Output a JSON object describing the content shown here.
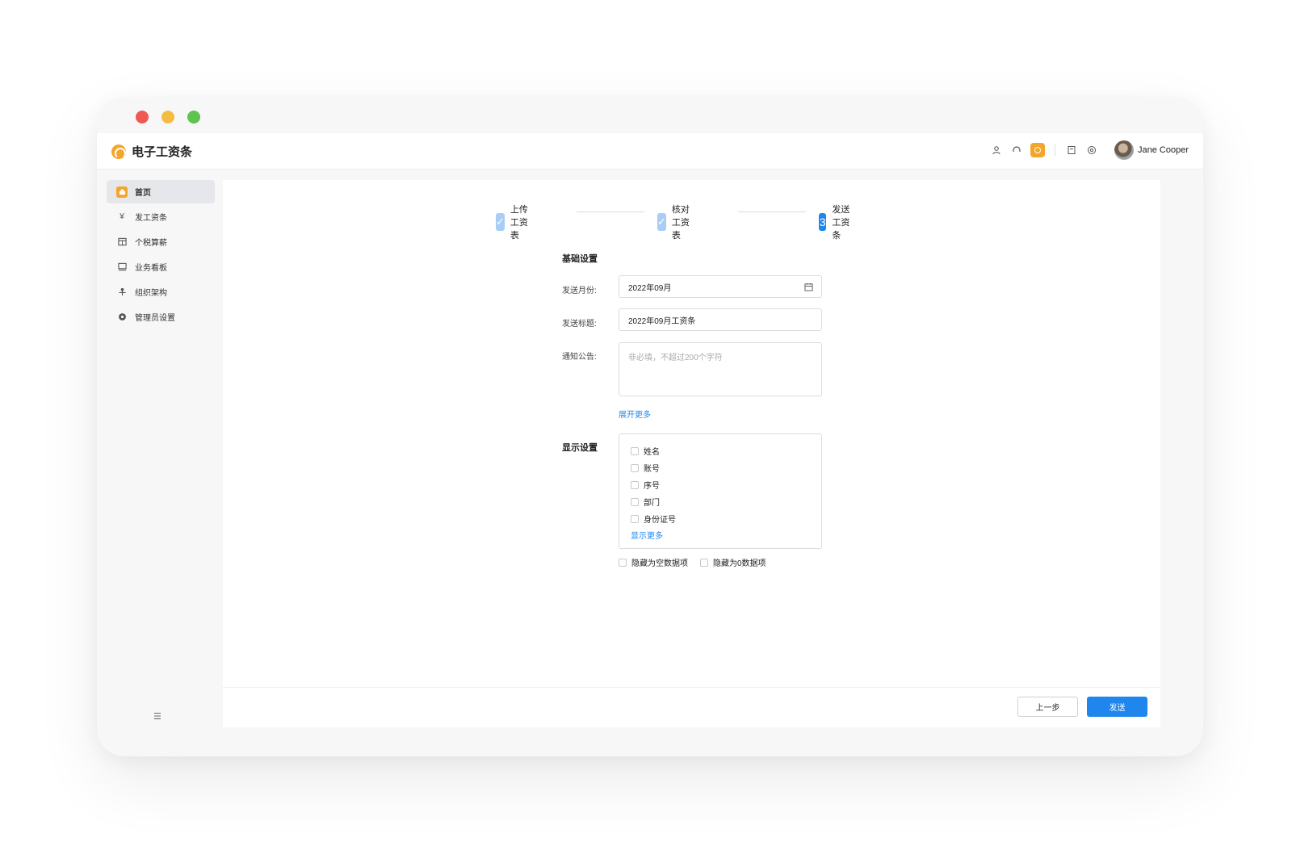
{
  "app": {
    "title": "电子工资条"
  },
  "user": {
    "name": "Jane Cooper"
  },
  "topbar_icons": [
    "user-icon",
    "headset-icon",
    "badge-icon",
    "book-icon",
    "settings-icon"
  ],
  "sidebar": {
    "items": [
      {
        "label": "首页",
        "icon": "home-icon",
        "active": true
      },
      {
        "label": "发工资条",
        "icon": "yen-icon",
        "active": false
      },
      {
        "label": "个税算薪",
        "icon": "calculator-icon",
        "active": false
      },
      {
        "label": "业务看板",
        "icon": "dashboard-icon",
        "active": false
      },
      {
        "label": "组织架构",
        "icon": "org-chart-icon",
        "active": false
      },
      {
        "label": "管理员设置",
        "icon": "settings-icon",
        "active": false
      }
    ]
  },
  "steps": [
    {
      "label": "上传工资表",
      "status": "done"
    },
    {
      "label": "核对工资表",
      "status": "done"
    },
    {
      "label": "发送工资条",
      "status": "current",
      "number": "3"
    }
  ],
  "basic": {
    "title": "基础设置",
    "month_label": "发送月份:",
    "month_value": "2022年09月",
    "subject_label": "发送标题:",
    "subject_value": "2022年09月工资条",
    "notice_label": "通知公告:",
    "notice_placeholder": "非必填，不超过200个字符",
    "expand_link": "展开更多"
  },
  "display": {
    "title": "显示设置",
    "fields": [
      "姓名",
      "账号",
      "序号",
      "部门",
      "身份证号"
    ],
    "more_link": "显示更多",
    "hide_empty": "隐藏为空数据项",
    "hide_zero": "隐藏为0数据项"
  },
  "buttons": {
    "prev": "上一步",
    "send": "发送"
  },
  "colors": {
    "primary": "#1e86ec",
    "brand": "#f4a62a"
  }
}
